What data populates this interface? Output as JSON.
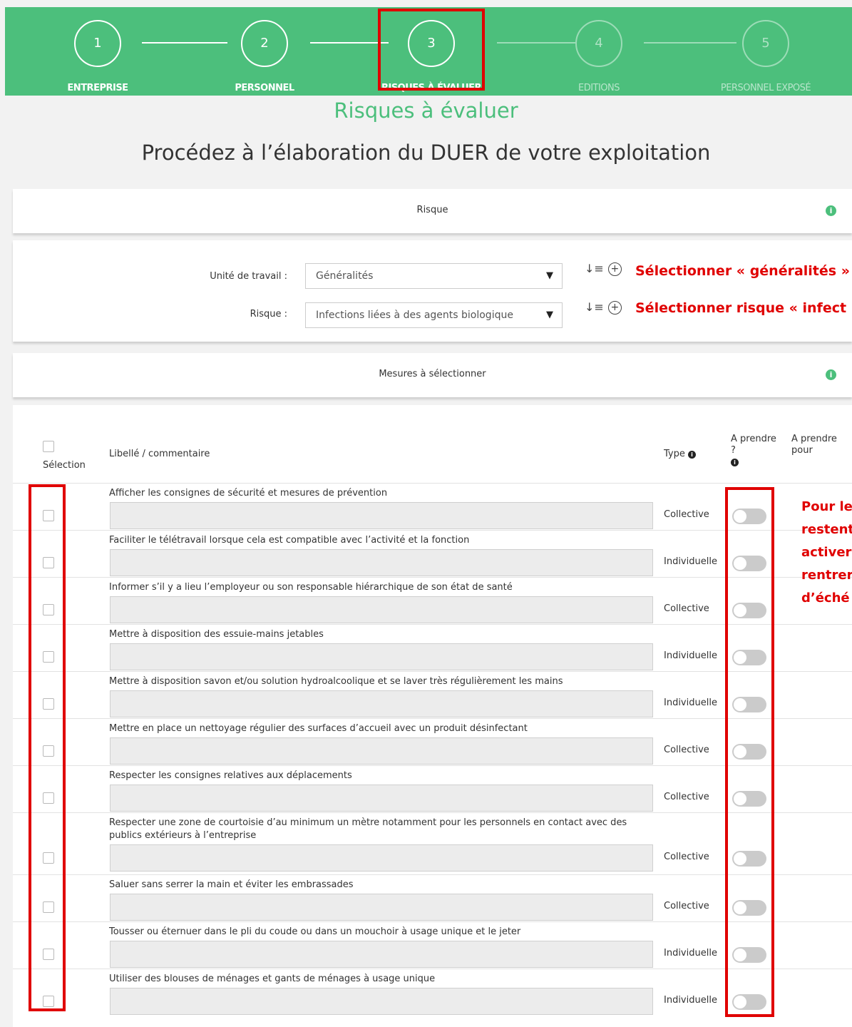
{
  "stepper": {
    "steps": [
      {
        "number": "1",
        "label": "ENTREPRISE"
      },
      {
        "number": "2",
        "label": "PERSONNEL"
      },
      {
        "number": "3",
        "label": "RISQUES À ÉVALUER"
      },
      {
        "number": "4",
        "label": "EDITIONS"
      },
      {
        "number": "5",
        "label": "PERSONNEL EXPOSÉ"
      }
    ],
    "active_step": 3
  },
  "page": {
    "section_title": "Risques à évaluer",
    "heading": "Procédez à l’élaboration du DUER de votre exploitation"
  },
  "risk_panel": {
    "title": "Risque",
    "info_icon": "i"
  },
  "form": {
    "work_unit_label": "Unité de travail :",
    "work_unit_value": "Généralités",
    "risk_label": "Risque :",
    "risk_value": "Infections liées à des agents biologique",
    "annotation_unit": "Sélectionner « généralités »",
    "annotation_risk": "Sélectionner risque « infect"
  },
  "measures_panel": {
    "title": "Mesures à sélectionner",
    "info_icon": "i"
  },
  "table": {
    "headers": {
      "selection": "Sélection",
      "label": "Libellé / commentaire",
      "type": "Type",
      "to_take": "A prendre ?",
      "to_take_for": "A prendre pour"
    },
    "rows": [
      {
        "label": "Afficher les consignes de sécurité et mesures de prévention",
        "type": "Collective",
        "selected": false,
        "to_take": false
      },
      {
        "label": "Faciliter le télétravail lorsque cela est compatible avec l’activité et la fonction",
        "type": "Individuelle",
        "selected": false,
        "to_take": false
      },
      {
        "label": "Informer s’il y a lieu l’employeur ou son responsable hiérarchique de son état de santé",
        "type": "Collective",
        "selected": false,
        "to_take": false
      },
      {
        "label": "Mettre à disposition des essuie-mains jetables",
        "type": "Individuelle",
        "selected": false,
        "to_take": false
      },
      {
        "label": "Mettre à disposition savon et/ou solution hydroalcoolique et se laver très régulièrement les mains",
        "type": "Individuelle",
        "selected": false,
        "to_take": false
      },
      {
        "label": "Mettre en place un nettoyage régulier des surfaces d’accueil avec un produit désinfectant",
        "type": "Collective",
        "selected": false,
        "to_take": false
      },
      {
        "label": "Respecter les consignes relatives aux déplacements",
        "type": "Collective",
        "selected": false,
        "to_take": false
      },
      {
        "label": "Respecter une zone de courtoisie d’au minimum un mètre notamment pour les personnels en contact avec des publics extérieurs à l’entreprise",
        "type": "Collective",
        "selected": false,
        "to_take": false
      },
      {
        "label": "Saluer sans serrer la main et éviter les embrassades",
        "type": "Collective",
        "selected": false,
        "to_take": false
      },
      {
        "label": "Tousser ou éternuer dans le pli du coude ou dans un mouchoir à usage unique et le jeter",
        "type": "Individuelle",
        "selected": false,
        "to_take": false
      },
      {
        "label": "Utiliser des blouses de ménages et gants de ménages à usage unique",
        "type": "Individuelle",
        "selected": false,
        "to_take": false
      }
    ]
  },
  "side_note": [
    "Pour le",
    "restent",
    "activer",
    "rentrer",
    "d’éché"
  ],
  "colors": {
    "accent_green": "#4cbf7c",
    "annotation_red": "#e00000"
  }
}
